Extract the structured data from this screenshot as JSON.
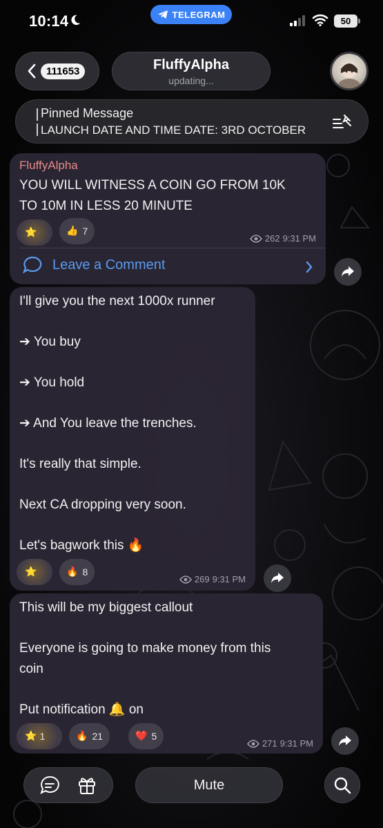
{
  "status_bar": {
    "time": "10:14",
    "moon_icon": "moon-icon",
    "app_pill": "TELEGRAM",
    "battery": "50"
  },
  "header": {
    "back_count": "111653",
    "channel_name": "FluffyAlpha",
    "channel_status": "updating..."
  },
  "pinned": {
    "title": "Pinned Message",
    "text": "LAUNCH DATE AND TIME DATE: 3RD OCTOBER"
  },
  "messages": [
    {
      "author": "FluffyAlpha",
      "lines": [
        "YOU WILL WITNESS A COIN GO FROM 10K",
        "TO 10M IN LESS 20 MINUTE"
      ],
      "reactions": [
        {
          "emoji": "⭐",
          "count": ""
        },
        {
          "emoji": "👍",
          "count": "7"
        }
      ],
      "views": "262",
      "time": "9:31 PM",
      "comment_label": "Leave a Comment"
    },
    {
      "lines": [
        "I'll give you the next 1000x runner",
        "",
        "➔ You buy",
        "",
        "➔ You hold",
        "",
        "➔ And You leave the trenches.",
        "",
        "It's really that simple.",
        "",
        "Next CA dropping very soon.",
        "",
        "Let's bagwork this 🔥"
      ],
      "reactions": [
        {
          "emoji": "⭐",
          "count": ""
        },
        {
          "emoji": "🔥",
          "count": "8"
        }
      ],
      "views": "269",
      "time": "9:31 PM"
    },
    {
      "lines": [
        "This will be my biggest callout",
        "",
        "Everyone is going to make money from this",
        "coin",
        "",
        "Put notification 🔔 on"
      ],
      "reactions": [
        {
          "emoji": "⭐",
          "count": "1"
        },
        {
          "emoji": "🔥",
          "count": "21"
        },
        {
          "emoji": "❤️",
          "count": "5"
        }
      ],
      "views": "271",
      "time": "9:31 PM"
    }
  ],
  "bottom_bar": {
    "mute_label": "Mute",
    "icons": [
      "chat-icon",
      "gift-icon",
      "search-icon"
    ]
  },
  "colors": {
    "author": "#e88b8b",
    "link": "#5a9cf0",
    "telegram_pill": "#3b82f6",
    "bubble": "#2c2634"
  }
}
